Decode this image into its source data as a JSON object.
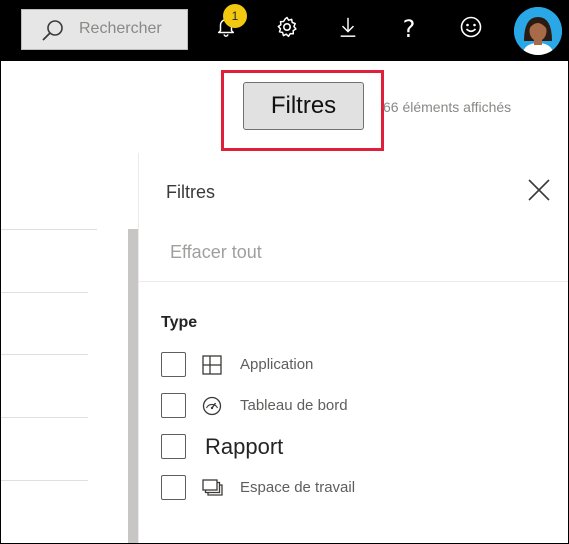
{
  "topbar": {
    "search_placeholder": "Rechercher",
    "notification_count": "1",
    "help_glyph": "?",
    "icons": [
      "search-icon",
      "bell-icon",
      "gear-icon",
      "download-icon",
      "help-icon",
      "smiley-icon",
      "avatar"
    ]
  },
  "header": {
    "filters_button_label": "Filtres",
    "items_count": "66 éléments affichés"
  },
  "filter_pane": {
    "title": "Filtres",
    "clear_all": "Effacer tout",
    "type_heading": "Type",
    "options": [
      {
        "label": "Application",
        "icon": "app-icon",
        "checked": false
      },
      {
        "label": "Tableau de bord",
        "icon": "dashboard-gauge-icon",
        "checked": false
      },
      {
        "label": "Rapport",
        "icon": "",
        "checked": false
      },
      {
        "label": "Espace de travail",
        "icon": "workspace-icon",
        "checked": false
      }
    ]
  },
  "colors": {
    "topbar_bg": "#000000",
    "badge": "#f2c811",
    "highlight": "#e0203a",
    "avatar_bg": "#2aa7e6"
  }
}
